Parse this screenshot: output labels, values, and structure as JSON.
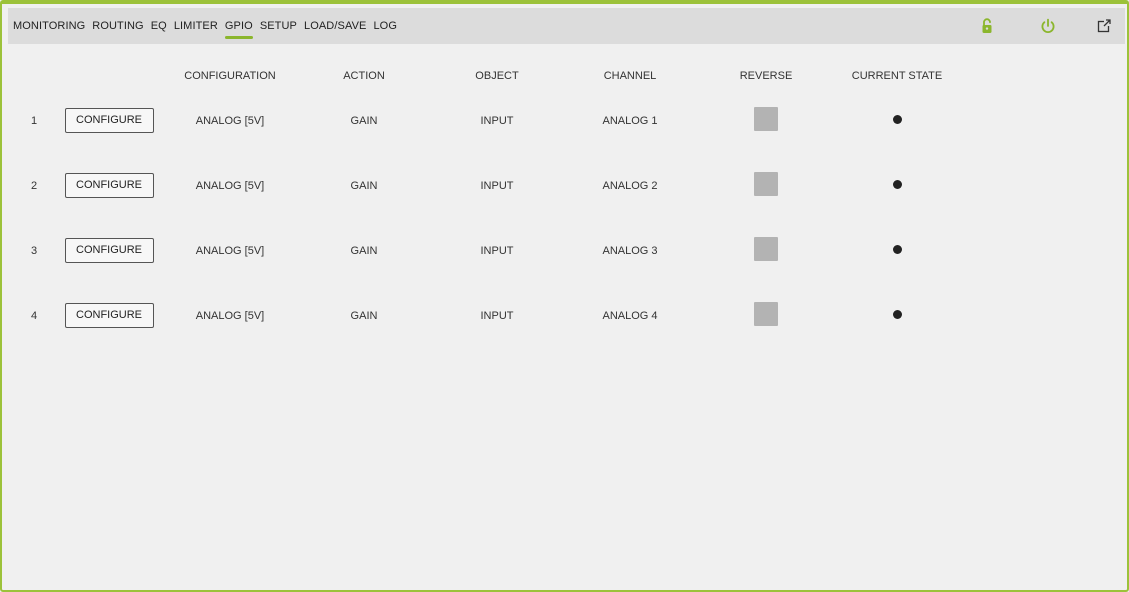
{
  "nav": {
    "items": [
      {
        "label": "MONITORING"
      },
      {
        "label": "ROUTING"
      },
      {
        "label": "EQ"
      },
      {
        "label": "LIMITER"
      },
      {
        "label": "GPIO"
      },
      {
        "label": "SETUP"
      },
      {
        "label": "LOAD/SAVE"
      },
      {
        "label": "LOG"
      }
    ],
    "active": "GPIO"
  },
  "icons": {
    "lock": "unlocked-padlock-icon",
    "power": "power-icon",
    "expand": "fullscreen-expand-icon",
    "accent_color": "#8bb62d"
  },
  "table": {
    "headers": {
      "configuration": "CONFIGURATION",
      "action": "ACTION",
      "object": "OBJECT",
      "channel": "CHANNEL",
      "reverse": "REVERSE",
      "current_state": "CURRENT STATE"
    },
    "rows": [
      {
        "num": "1",
        "button": "CONFIGURE",
        "configuration": "ANALOG [5V]",
        "action": "GAIN",
        "object": "INPUT",
        "channel": "ANALOG 1",
        "reverse": false,
        "state": "on"
      },
      {
        "num": "2",
        "button": "CONFIGURE",
        "configuration": "ANALOG [5V]",
        "action": "GAIN",
        "object": "INPUT",
        "channel": "ANALOG 2",
        "reverse": false,
        "state": "on"
      },
      {
        "num": "3",
        "button": "CONFIGURE",
        "configuration": "ANALOG [5V]",
        "action": "GAIN",
        "object": "INPUT",
        "channel": "ANALOG 3",
        "reverse": false,
        "state": "on"
      },
      {
        "num": "4",
        "button": "CONFIGURE",
        "configuration": "ANALOG [5V]",
        "action": "GAIN",
        "object": "INPUT",
        "channel": "ANALOG 4",
        "reverse": false,
        "state": "on"
      }
    ]
  }
}
